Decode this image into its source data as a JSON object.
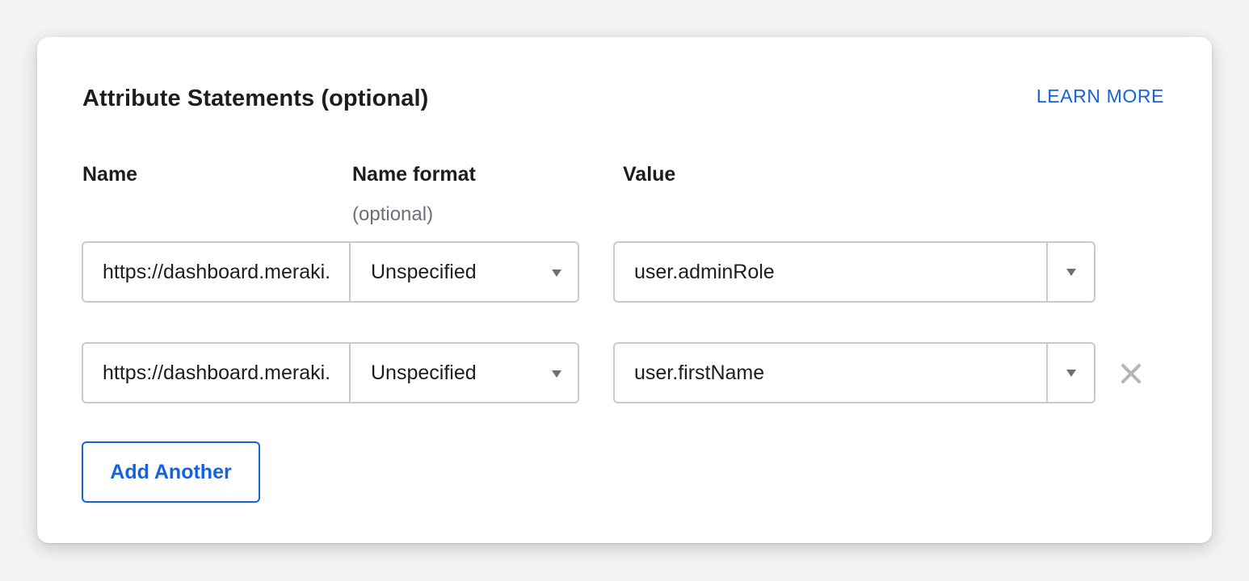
{
  "section": {
    "title": "Attribute Statements (optional)",
    "learn_more": "LEARN MORE"
  },
  "columns": {
    "name": "Name",
    "name_format": "Name format",
    "name_format_sub": "(optional)",
    "value": "Value"
  },
  "rows": [
    {
      "name": "https://dashboard.meraki.com/saml/attributes/role",
      "name_format": "Unspecified",
      "value": "user.adminRole",
      "removable": false
    },
    {
      "name": "https://dashboard.meraki.com/saml/attributes/username",
      "name_format": "Unspecified",
      "value": "user.firstName",
      "removable": true
    }
  ],
  "actions": {
    "add_another": "Add Another"
  },
  "icons": {
    "select_caret": "chevron-down-icon",
    "remove": "close-icon"
  },
  "colors": {
    "accent": "#1662dd",
    "border": "#c9c9ce",
    "muted_text": "#6e6e78",
    "remove_icon": "#b4b4ba"
  }
}
